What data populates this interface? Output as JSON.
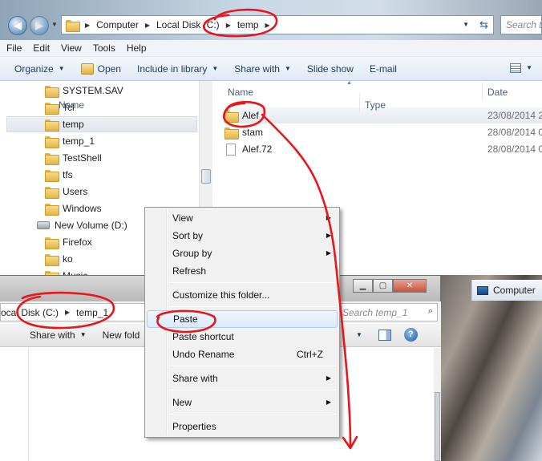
{
  "top_window": {
    "breadcrumb": [
      "Computer",
      "Local Disk (C:)",
      "temp"
    ],
    "search_placeholder": "Search te",
    "menu": [
      "File",
      "Edit",
      "View",
      "Tools",
      "Help"
    ],
    "toolbar": {
      "organize": "Organize",
      "open": "Open",
      "include_in_library": "Include in library",
      "share_with": "Share with",
      "slide_show": "Slide show",
      "email": "E-mail"
    },
    "nav_tree": [
      {
        "label": "SYSTEM.SAV",
        "kind": "folder"
      },
      {
        "label": "Tcl",
        "kind": "folder"
      },
      {
        "label": "temp",
        "kind": "folder",
        "selected": true
      },
      {
        "label": "temp_1",
        "kind": "folder"
      },
      {
        "label": "TestShell",
        "kind": "folder"
      },
      {
        "label": "tfs",
        "kind": "folder"
      },
      {
        "label": "Users",
        "kind": "folder"
      },
      {
        "label": "Windows",
        "kind": "folder"
      },
      {
        "label": "New Volume (D:)",
        "kind": "drive"
      },
      {
        "label": "Firefox",
        "kind": "folder"
      },
      {
        "label": "ko",
        "kind": "folder"
      },
      {
        "label": "Music",
        "kind": "folder"
      }
    ],
    "columns": {
      "name": "Name",
      "date": "Date"
    },
    "files": [
      {
        "name": "Alef",
        "date": "23/08/2014 2",
        "kind": "folder",
        "selected": true
      },
      {
        "name": "stam",
        "date": "28/08/2014 0",
        "kind": "folder"
      },
      {
        "name": "Alef.72",
        "date": "28/08/2014 0",
        "kind": "file"
      }
    ]
  },
  "bottom_window": {
    "breadcrumb": [
      "ocal Disk (C:)",
      "temp_1"
    ],
    "search_placeholder": "Search temp_1",
    "toolbar": {
      "share_with": "Share with",
      "new_folder": "New fold"
    },
    "columns": {
      "name": "Name",
      "type": "Type"
    },
    "taskbar_computer": "Computer"
  },
  "context_menu": {
    "items": [
      {
        "label": "View",
        "submenu": true
      },
      {
        "label": "Sort by",
        "submenu": true
      },
      {
        "label": "Group by",
        "submenu": true
      },
      {
        "label": "Refresh"
      },
      {
        "separator": true
      },
      {
        "label": "Customize this folder..."
      },
      {
        "separator": true
      },
      {
        "label": "Paste",
        "highlighted": true
      },
      {
        "label": "Paste shortcut"
      },
      {
        "label": "Undo Rename",
        "shortcut": "Ctrl+Z"
      },
      {
        "separator": true
      },
      {
        "label": "Share with",
        "submenu": true
      },
      {
        "separator": true
      },
      {
        "label": "New",
        "submenu": true
      },
      {
        "separator": true
      },
      {
        "label": "Properties"
      }
    ]
  },
  "colors": {
    "annotation": "#e8151b",
    "toolbar_text": "#1e395b",
    "menu_hover_border": "#aeccf2"
  }
}
